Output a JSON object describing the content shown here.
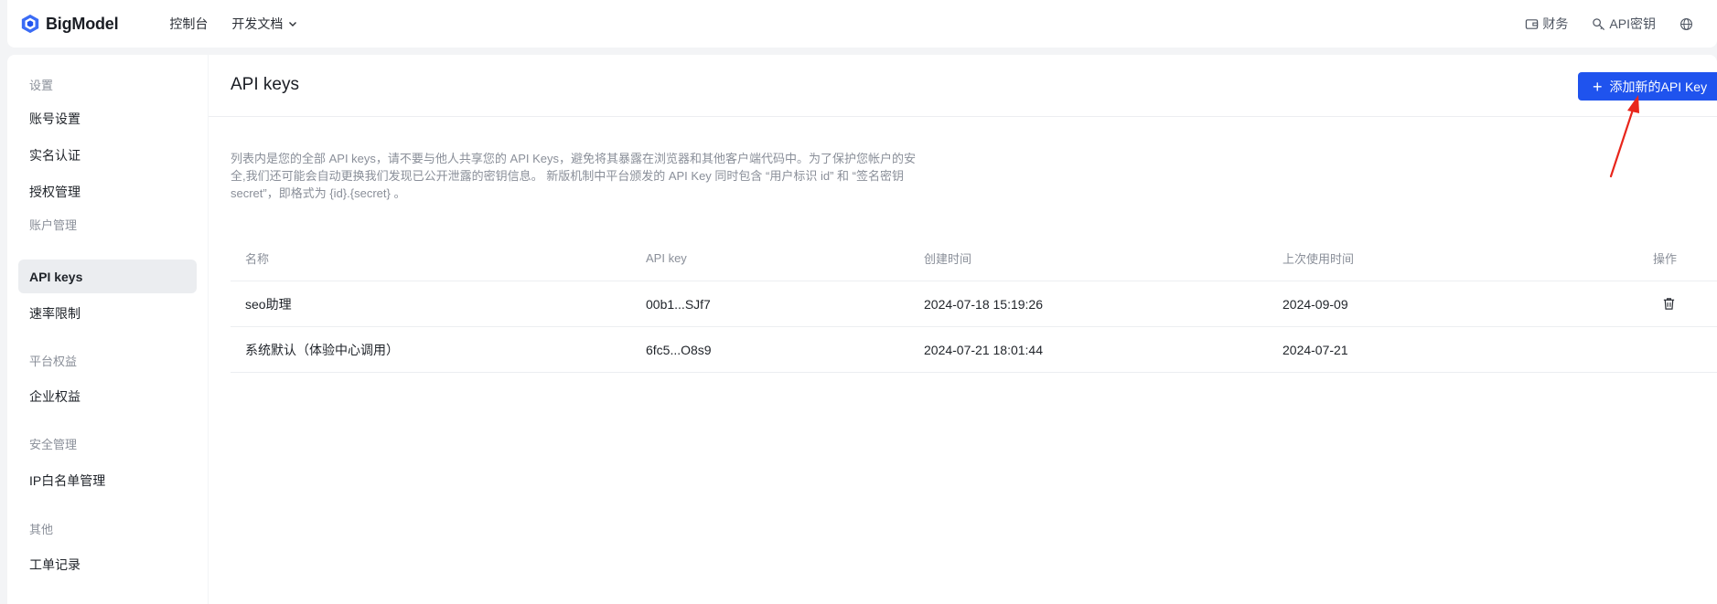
{
  "brand": {
    "name": "BigModel"
  },
  "topnav": {
    "console": "控制台",
    "docs": "开发文档"
  },
  "topright": {
    "finance": "财务",
    "api_key": "API密钥"
  },
  "sidebar": {
    "groups": [
      {
        "label": "设置",
        "items": [
          "账号设置",
          "实名认证",
          "授权管理"
        ]
      },
      {
        "label": "账户管理",
        "items": [
          "API keys",
          "速率限制"
        ]
      },
      {
        "label": "平台权益",
        "items": [
          "企业权益"
        ]
      },
      {
        "label": "安全管理",
        "items": [
          "IP白名单管理"
        ]
      },
      {
        "label": "其他",
        "items": [
          "工单记录"
        ]
      }
    ],
    "active": "API keys"
  },
  "main": {
    "title": "API keys",
    "add_button": "添加新的API Key",
    "description": "列表内是您的全部 API keys，请不要与他人共享您的 API Keys，避免将其暴露在浏览器和其他客户端代码中。为了保护您帐户的安全,我们还可能会自动更换我们发现已公开泄露的密钥信息。 新版机制中平台颁发的 API Key 同时包含 “用户标识 id” 和 “签名密钥 secret”，即格式为 {id}.{secret} 。"
  },
  "table": {
    "headers": {
      "name": "名称",
      "key": "API key",
      "created": "创建时间",
      "last_used": "上次使用时间",
      "action": "操作"
    },
    "rows": [
      {
        "name": "seo助理",
        "key": "00b1...SJf7",
        "created": "2024-07-18 15:19:26",
        "last_used": "2024-09-09",
        "delete": true
      },
      {
        "name": "系统默认（体验中心调用）",
        "key": "6fc5...O8s9",
        "created": "2024-07-21 18:01:44",
        "last_used": "2024-07-21",
        "delete": false
      }
    ]
  },
  "colors": {
    "primary": "#1f53ee",
    "annotation": "#e8261c"
  },
  "icons": [
    "bigmodel-logo-icon",
    "chevron-down-icon",
    "wallet-icon",
    "key-icon",
    "globe-icon",
    "plus-icon",
    "trash-icon",
    "annotation-arrow-icon"
  ]
}
